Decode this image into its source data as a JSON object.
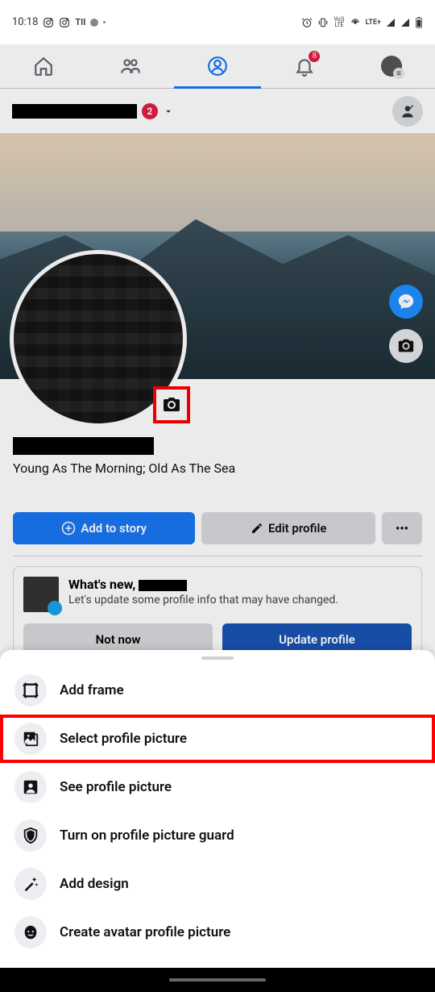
{
  "statusbar": {
    "time": "10:18",
    "left_icons": [
      "instagram-icon",
      "instagram-icon",
      "tii-text",
      "dot-icon",
      "small-dot-icon"
    ],
    "right_icons": [
      "alarm-icon",
      "vibrate-icon",
      "volte-icon",
      "hotspot-icon",
      "lte-plus-text",
      "signal-icon",
      "signal-icon",
      "battery-icon"
    ],
    "lte_label": "LTE+",
    "volte_label": "Vo))\nLTE"
  },
  "topnav": {
    "tabs": [
      "home",
      "friends",
      "profile",
      "notifications",
      "menu"
    ],
    "active": "profile",
    "notif_badge": "8"
  },
  "titlebar": {
    "badge": "2"
  },
  "cover": {
    "profile_camera_highlighted": true
  },
  "profile": {
    "bio": "Young As The Morning; Old As The Sea"
  },
  "actions": {
    "add_to_story": "Add to story",
    "edit_profile": "Edit profile",
    "more": "•••"
  },
  "update_card": {
    "title_prefix": "What's new, ",
    "title_suffix": "",
    "subtitle": "Let's update some profile info that may have changed.",
    "not_now": "Not now",
    "update": "Update profile"
  },
  "sheet": {
    "options": [
      {
        "id": "add-frame",
        "label": "Add frame",
        "icon": "frame-icon",
        "highlight": false
      },
      {
        "id": "select-profile-picture",
        "label": "Select profile picture",
        "icon": "picture-icon",
        "highlight": true
      },
      {
        "id": "see-profile-picture",
        "label": "See profile picture",
        "icon": "person-square-icon",
        "highlight": false
      },
      {
        "id": "turn-on-guard",
        "label": "Turn on profile picture guard",
        "icon": "shield-icon",
        "highlight": false
      },
      {
        "id": "add-design",
        "label": "Add design",
        "icon": "wand-icon",
        "highlight": false
      },
      {
        "id": "create-avatar",
        "label": "Create avatar profile picture",
        "icon": "avatar-face-icon",
        "highlight": false
      }
    ]
  }
}
